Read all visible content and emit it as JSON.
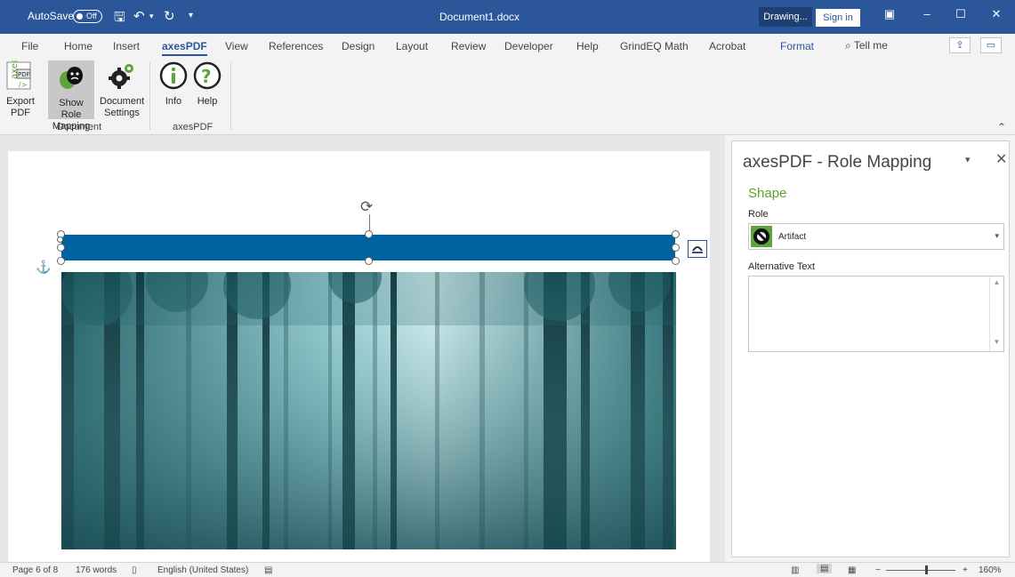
{
  "titlebar": {
    "autosave_label": "AutoSave",
    "autosave_state": "Off",
    "document_title": "Document1.docx",
    "drawing_label": "Drawing...",
    "signin_label": "Sign in"
  },
  "tabs": [
    {
      "label": "File"
    },
    {
      "label": "Home"
    },
    {
      "label": "Insert"
    },
    {
      "label": "axesPDF"
    },
    {
      "label": "View"
    },
    {
      "label": "References"
    },
    {
      "label": "Design"
    },
    {
      "label": "Layout"
    },
    {
      "label": "Review"
    },
    {
      "label": "Developer"
    },
    {
      "label": "Help"
    },
    {
      "label": "GrindEQ Math"
    },
    {
      "label": "Acrobat"
    },
    {
      "label": "Format"
    }
  ],
  "tell_me": "Tell me",
  "ribbon": {
    "document_group": {
      "label": "Document",
      "export_line1": "Export",
      "export_line2": "PDF",
      "role_line1": "Show Role",
      "role_line2": "Mapping",
      "settings_line1": "Document",
      "settings_line2": "Settings"
    },
    "axespdf_group": {
      "label": "axesPDF",
      "info": "Info",
      "help": "Help"
    }
  },
  "pane": {
    "title": "axesPDF - Role Mapping",
    "section": "Shape",
    "role_label": "Role",
    "role_value": "Artifact",
    "alt_label": "Alternative Text",
    "alt_value": ""
  },
  "status": {
    "page": "Page 6 of 8",
    "words": "176 words",
    "language": "English (United States)",
    "zoom": "160%"
  },
  "colors": {
    "brand": "#2b579a",
    "shape_fill": "#0063a1",
    "accent_green": "#5f9e2f"
  }
}
